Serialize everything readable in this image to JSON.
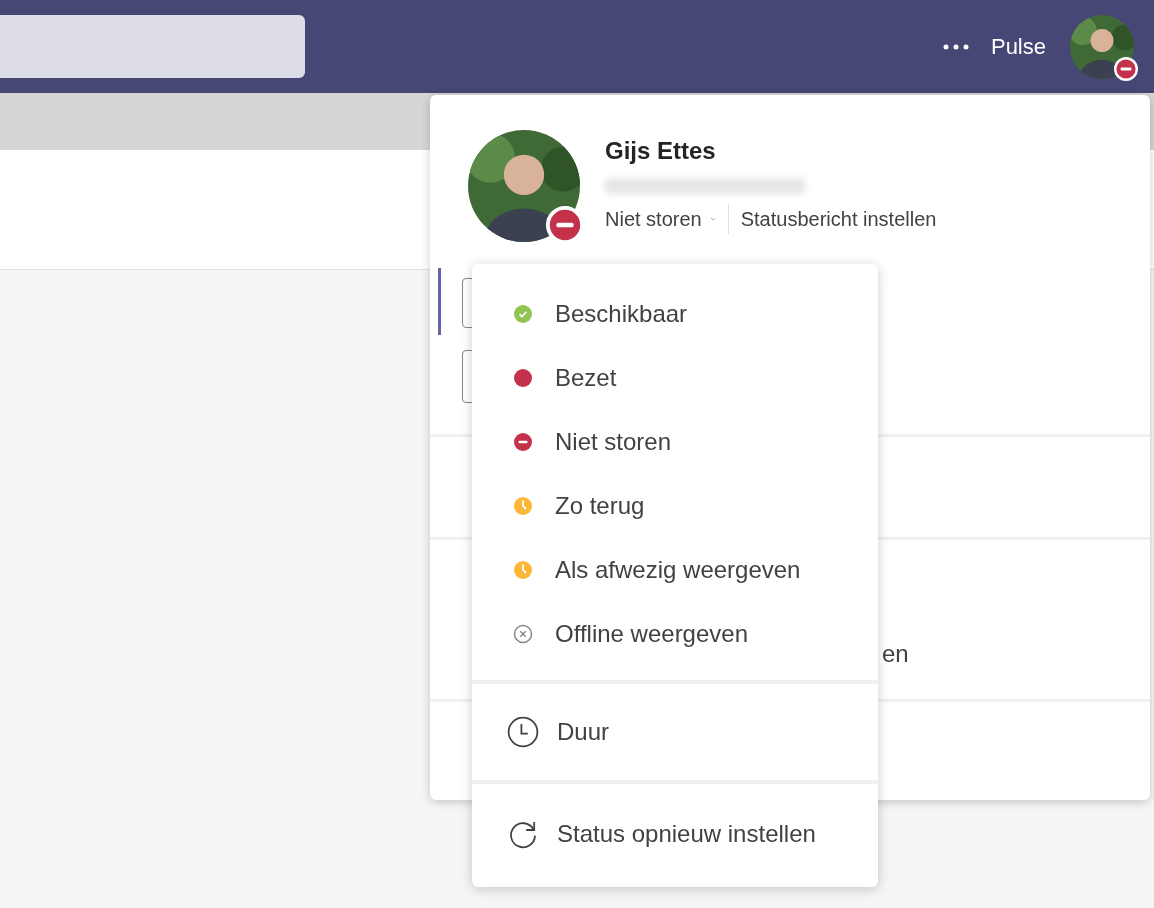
{
  "top_bar": {
    "app_name": "Pulse",
    "do_not_disturb": true
  },
  "profile": {
    "name": "Gijs Ettes",
    "status": "Niet storen",
    "do_not_disturb": true,
    "set_status_message": "Statusbericht instellen",
    "hidden_fragment": "en"
  },
  "status_menu": {
    "statuses": [
      {
        "label": "Beschikbaar",
        "kind": "available",
        "color": "#92c353"
      },
      {
        "label": "Bezet",
        "kind": "busy",
        "color": "#c4314b"
      },
      {
        "label": "Niet storen",
        "kind": "dnd",
        "color": "#c4314b"
      },
      {
        "label": "Zo terug",
        "kind": "away",
        "color": "#fcb737"
      },
      {
        "label": "Als afwezig weergeven",
        "kind": "away",
        "color": "#fcb737"
      },
      {
        "label": "Offline weergeven",
        "kind": "offline",
        "color": "#8a8886"
      }
    ],
    "actions": [
      {
        "label": "Duur",
        "kind": "duration"
      },
      {
        "label": "Status opnieuw instellen",
        "kind": "reset"
      }
    ]
  }
}
